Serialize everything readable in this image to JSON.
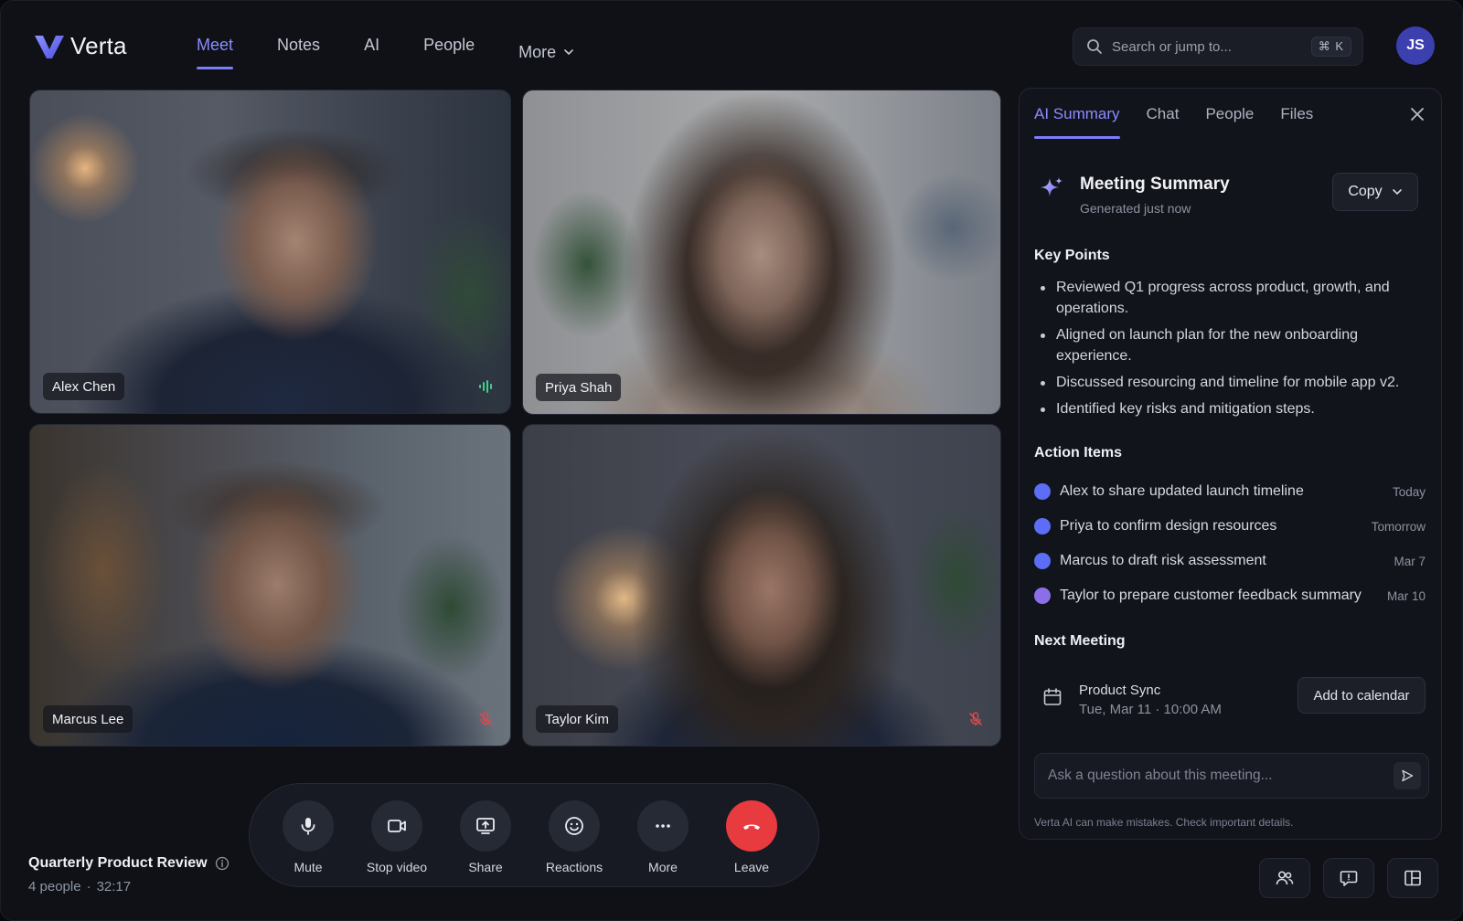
{
  "app": {
    "name": "Verta"
  },
  "nav": {
    "items": [
      "Meet",
      "Notes",
      "AI",
      "People",
      "More"
    ],
    "active": "Meet"
  },
  "search": {
    "placeholder": "Search or jump to...",
    "shortcut": "⌘ K"
  },
  "user": {
    "initials": "JS"
  },
  "participants": [
    {
      "name": "Alex Chen",
      "status": "speaking"
    },
    {
      "name": "Priya Shah",
      "status": "unmuted"
    },
    {
      "name": "Marcus Lee",
      "status": "muted"
    },
    {
      "name": "Taylor Kim",
      "status": "muted"
    }
  ],
  "meeting": {
    "title": "Quarterly Product Review",
    "people": "4 people",
    "elapsed": "32:17"
  },
  "controls": {
    "mute": "Mute",
    "stop_video": "Stop video",
    "share": "Share",
    "reactions": "Reactions",
    "more": "More",
    "leave": "Leave"
  },
  "panel": {
    "tabs": [
      "AI Summary",
      "Chat",
      "People",
      "Files"
    ],
    "active_tab": "AI Summary",
    "summary_title": "Meeting Summary",
    "summary_sub": "Generated just now",
    "copy_label": "Copy",
    "key_points_title": "Key Points",
    "key_points": [
      "Reviewed Q1 progress across product, growth, and operations.",
      "Aligned on launch plan for the new onboarding experience.",
      "Discussed resourcing and timeline for mobile app v2.",
      "Identified key risks and mitigation steps."
    ],
    "action_items_title": "Action Items",
    "action_items": [
      {
        "text": "Alex to share updated launch timeline",
        "due": "Today",
        "color": "#5b6ef5"
      },
      {
        "text": "Priya to confirm design resources",
        "due": "Tomorrow",
        "color": "#5b6ef5"
      },
      {
        "text": "Marcus to draft risk assessment",
        "due": "Mar 7",
        "color": "#5b6ef5"
      },
      {
        "text": "Taylor to prepare customer feedback summary",
        "due": "Mar 10",
        "color": "#8b6fe8"
      }
    ],
    "next_meeting_title": "Next Meeting",
    "next_meeting": {
      "name": "Product Sync",
      "time": "Tue, Mar 11 · 10:00 AM",
      "add_label": "Add to calendar"
    },
    "ask_placeholder": "Ask a question about this meeting...",
    "disclaimer": "Verta AI can make mistakes. Check important details."
  },
  "colors": {
    "accent": "#7b7ef6",
    "leave": "#e83b3f",
    "speaking": "#3fcf8e",
    "muted": "#e0474c"
  }
}
